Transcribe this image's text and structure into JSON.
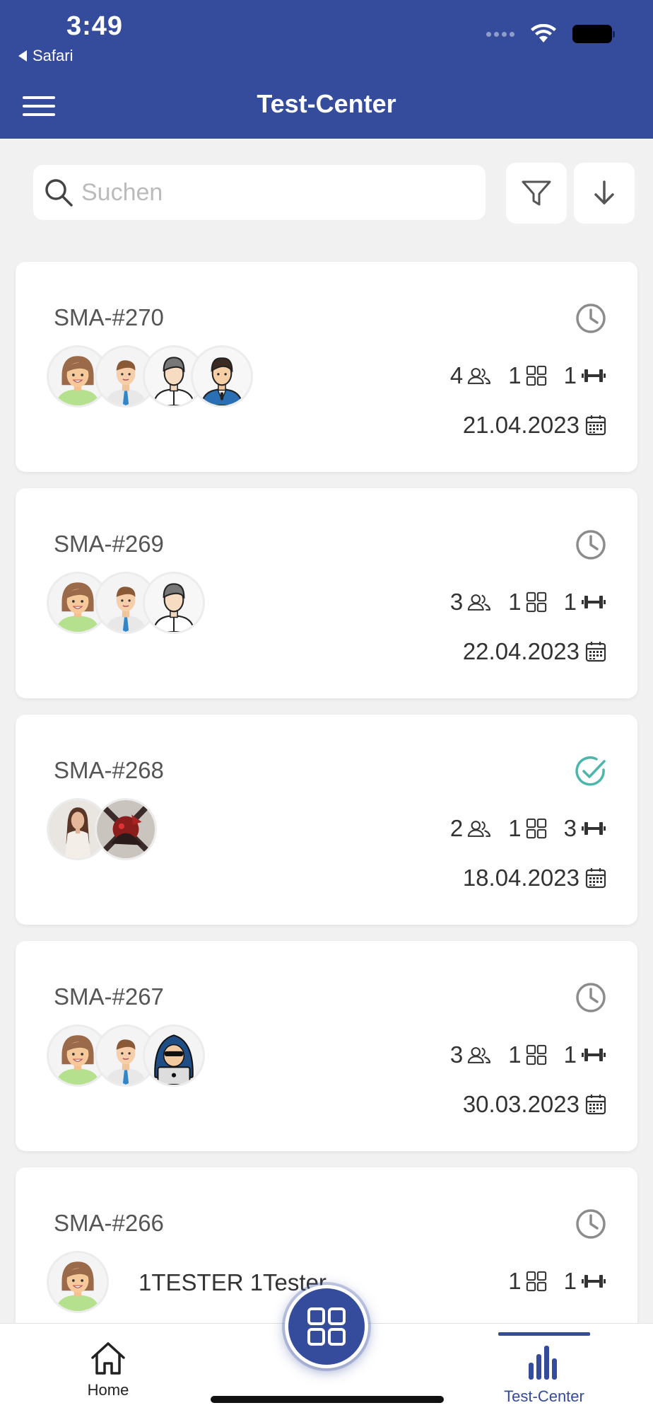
{
  "status_bar": {
    "time": "3:49",
    "back_app": "Safari"
  },
  "header": {
    "title": "Test-Center",
    "menu_icon": "hamburger-icon"
  },
  "search": {
    "placeholder": "Suchen",
    "value": ""
  },
  "toolbar": {
    "filter_icon": "filter-icon",
    "sort_icon": "arrow-down-icon"
  },
  "colors": {
    "primary": "#354b9c",
    "pending": "#8c8c8c",
    "done": "#4db6ac"
  },
  "cards": [
    {
      "id": "SMA-#270",
      "status": "pending",
      "testers": "4",
      "devices": "1",
      "tests": "1",
      "date": "21.04.2023",
      "avatars": [
        "woman-avatar",
        "businessman-avatar",
        "grey-man-avatar",
        "suit-man-avatar"
      ]
    },
    {
      "id": "SMA-#269",
      "status": "pending",
      "testers": "3",
      "devices": "1",
      "tests": "1",
      "date": "22.04.2023",
      "avatars": [
        "woman-avatar",
        "businessman-avatar",
        "grey-man-avatar"
      ]
    },
    {
      "id": "SMA-#268",
      "status": "done",
      "testers": "2",
      "devices": "1",
      "tests": "3",
      "date": "18.04.2023",
      "avatars": [
        "photo-woman-avatar",
        "photo-warrior-avatar"
      ]
    },
    {
      "id": "SMA-#267",
      "status": "pending",
      "testers": "3",
      "devices": "1",
      "tests": "1",
      "date": "30.03.2023",
      "avatars": [
        "woman-avatar",
        "businessman-avatar",
        "hacker-avatar"
      ]
    },
    {
      "id": "SMA-#266",
      "status": "pending",
      "tester_name": "1TESTER 1Tester",
      "devices": "1",
      "tests": "1",
      "date": "",
      "avatars": [
        "woman-avatar"
      ]
    }
  ],
  "bottom_nav": {
    "home_label": "Home",
    "testcenter_label": "Test-Center",
    "active": "Test-Center"
  }
}
